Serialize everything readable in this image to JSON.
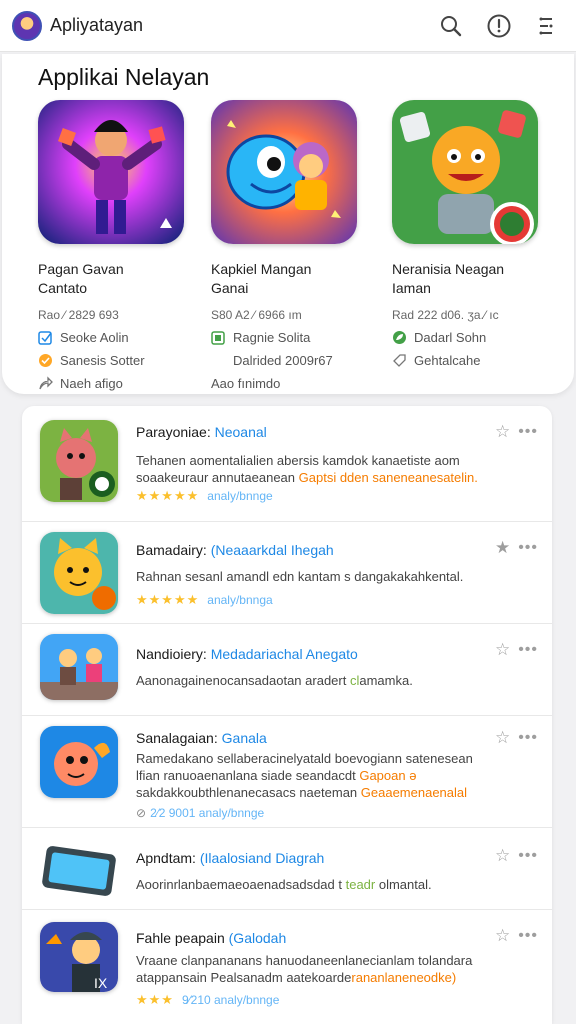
{
  "header": {
    "app_name": "Apliyatayan",
    "icons": [
      "search-icon",
      "alert-icon",
      "filter-icon"
    ]
  },
  "featured": {
    "title": "Applikai Nelayan",
    "apps": [
      {
        "name": "Pagan Gavan\nCantato",
        "meta": "Rao ⁄ 2829 693",
        "row1": "Seoke Aolin",
        "row2": "Sanesis Sotter",
        "row3": "Naeh afigo"
      },
      {
        "name": "Kapkiel Mangan\nGanai",
        "meta": "S80 A2 ⁄ 6966 ım",
        "row1": "Ragnie Solita",
        "row2": "Dalrided 2009r67",
        "row3": "Aao fınimdo"
      },
      {
        "name": "Neranisia Neagan\nIaman",
        "meta": "Rad 222 d06. ʒa.⁄ ıc",
        "row1": "Dadarl Sohn",
        "row2": "Gehtalcahe",
        "row3": ""
      }
    ]
  },
  "list": {
    "items": [
      {
        "title": "Parayoniae:",
        "tag": "Neoanal",
        "desc": "Tehanen aomentalialien abersis kamdok kanaetiste aom soaakeuraur annutaeanean ",
        "desc_hl": "Gaptsi dden saneneanesatelin.",
        "stars": "★★★★★",
        "rating_text": "analy/bnnge"
      },
      {
        "title": "Bamadairy:",
        "tag": "(Neaaarkdal Ihegah",
        "desc": "Rahnan sesanl amandl edn kantam s dangakakahkental.",
        "desc_hl": "",
        "stars": "★★★★★",
        "rating_text": "analy/bnnga"
      },
      {
        "title": "Nandioiery:",
        "tag": "Medadariachal Anegato",
        "desc": "Aanonagainenocansadaotan aradert ",
        "desc_hl2": "cl",
        "desc_tail": "amamka.",
        "stars": "",
        "rating_text": ""
      },
      {
        "title": "Sanalagaian:",
        "tag": "Ganala",
        "desc": "Ramedakano sellaberacinelyatald boevogiann satenesean lfian ranuoaenanlana siade seandacdt ",
        "desc_hl": "Gapoan ə",
        "desc2": "sakdakkoubthlenanecasacs naeteman ",
        "desc2_hl": "Geaaemenaenalal",
        "stars": "",
        "rating_text": "2⁄2 9001   analy/bnnge"
      },
      {
        "title": "Apndtam:",
        "tag": "(Ilaalosiand Diagrah",
        "desc": "Aoorinrlanbaemaeoaenadsadsdad t ",
        "desc_hl2": "teadr",
        "desc_tail": " olmantal.",
        "stars": "",
        "rating_text": ""
      },
      {
        "title": "Fahle peapain",
        "tag": "(Galodah",
        "desc": "Vraane clanpananans hanuodaneenlanecianlam tolandara atappansain Pealsanadm aatekoarde",
        "desc_hl": "rananlaneneodke)",
        "stars": "★★★",
        "rating_text": "9⁄210   analy/bnnge"
      }
    ]
  },
  "colors": {
    "accent": "#1e88e5",
    "highlight": "#f57c00",
    "star": "#fbc02d"
  }
}
